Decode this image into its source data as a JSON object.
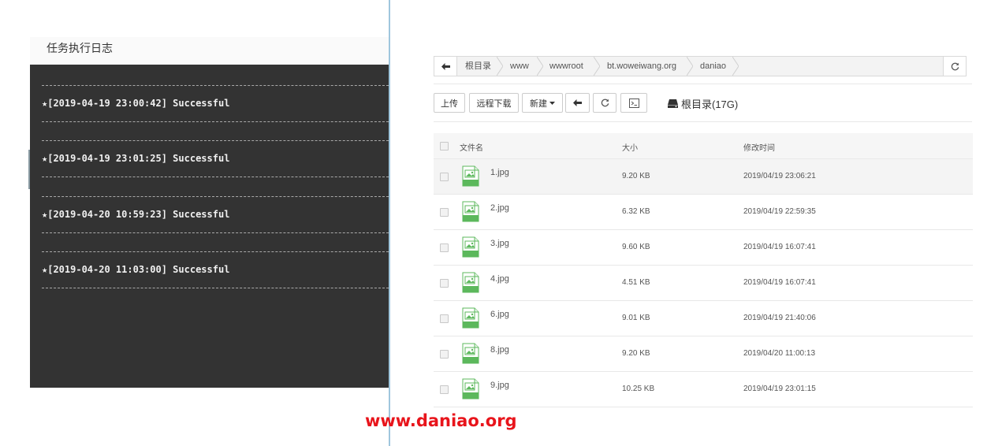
{
  "log_panel": {
    "title": "任务执行日志",
    "entries": [
      "★[2019-04-19 23:00:42] Successful",
      "★[2019-04-19 23:01:25] Successful",
      "★[2019-04-20 10:59:23] Successful",
      "★[2019-04-20 11:03:00] Successful"
    ]
  },
  "file_manager": {
    "breadcrumb": [
      "根目录",
      "www",
      "wwwroot",
      "bt.woweiwang.org",
      "daniao"
    ],
    "toolbar": {
      "upload": "上传",
      "remote_download": "远程下载",
      "new": "新建",
      "disk": "根目录(17G)"
    },
    "columns": {
      "name": "文件名",
      "size": "大小",
      "modified": "修改时间"
    },
    "files": [
      {
        "name": "1.jpg",
        "size": "9.20 KB",
        "modified": "2019/04/19 23:06:21"
      },
      {
        "name": "2.jpg",
        "size": "6.32 KB",
        "modified": "2019/04/19 22:59:35"
      },
      {
        "name": "3.jpg",
        "size": "9.60 KB",
        "modified": "2019/04/19 16:07:41"
      },
      {
        "name": "4.jpg",
        "size": "4.51 KB",
        "modified": "2019/04/19 16:07:41"
      },
      {
        "name": "6.jpg",
        "size": "9.01 KB",
        "modified": "2019/04/19 21:40:06"
      },
      {
        "name": "8.jpg",
        "size": "9.20 KB",
        "modified": "2019/04/20 11:00:13"
      },
      {
        "name": "9.jpg",
        "size": "10.25 KB",
        "modified": "2019/04/19 23:01:15"
      }
    ],
    "icons": {
      "back": "arrow-left-icon",
      "refresh": "refresh-icon",
      "terminal": "terminal-icon",
      "disk": "hard-drive-icon",
      "file": "jpg-file-icon"
    }
  },
  "watermark": "www.daniao.org",
  "colors": {
    "log_background": "#333333",
    "jpg_icon": "#5cb85c",
    "watermark": "#e8141b",
    "divider": "#9fc6dd"
  }
}
